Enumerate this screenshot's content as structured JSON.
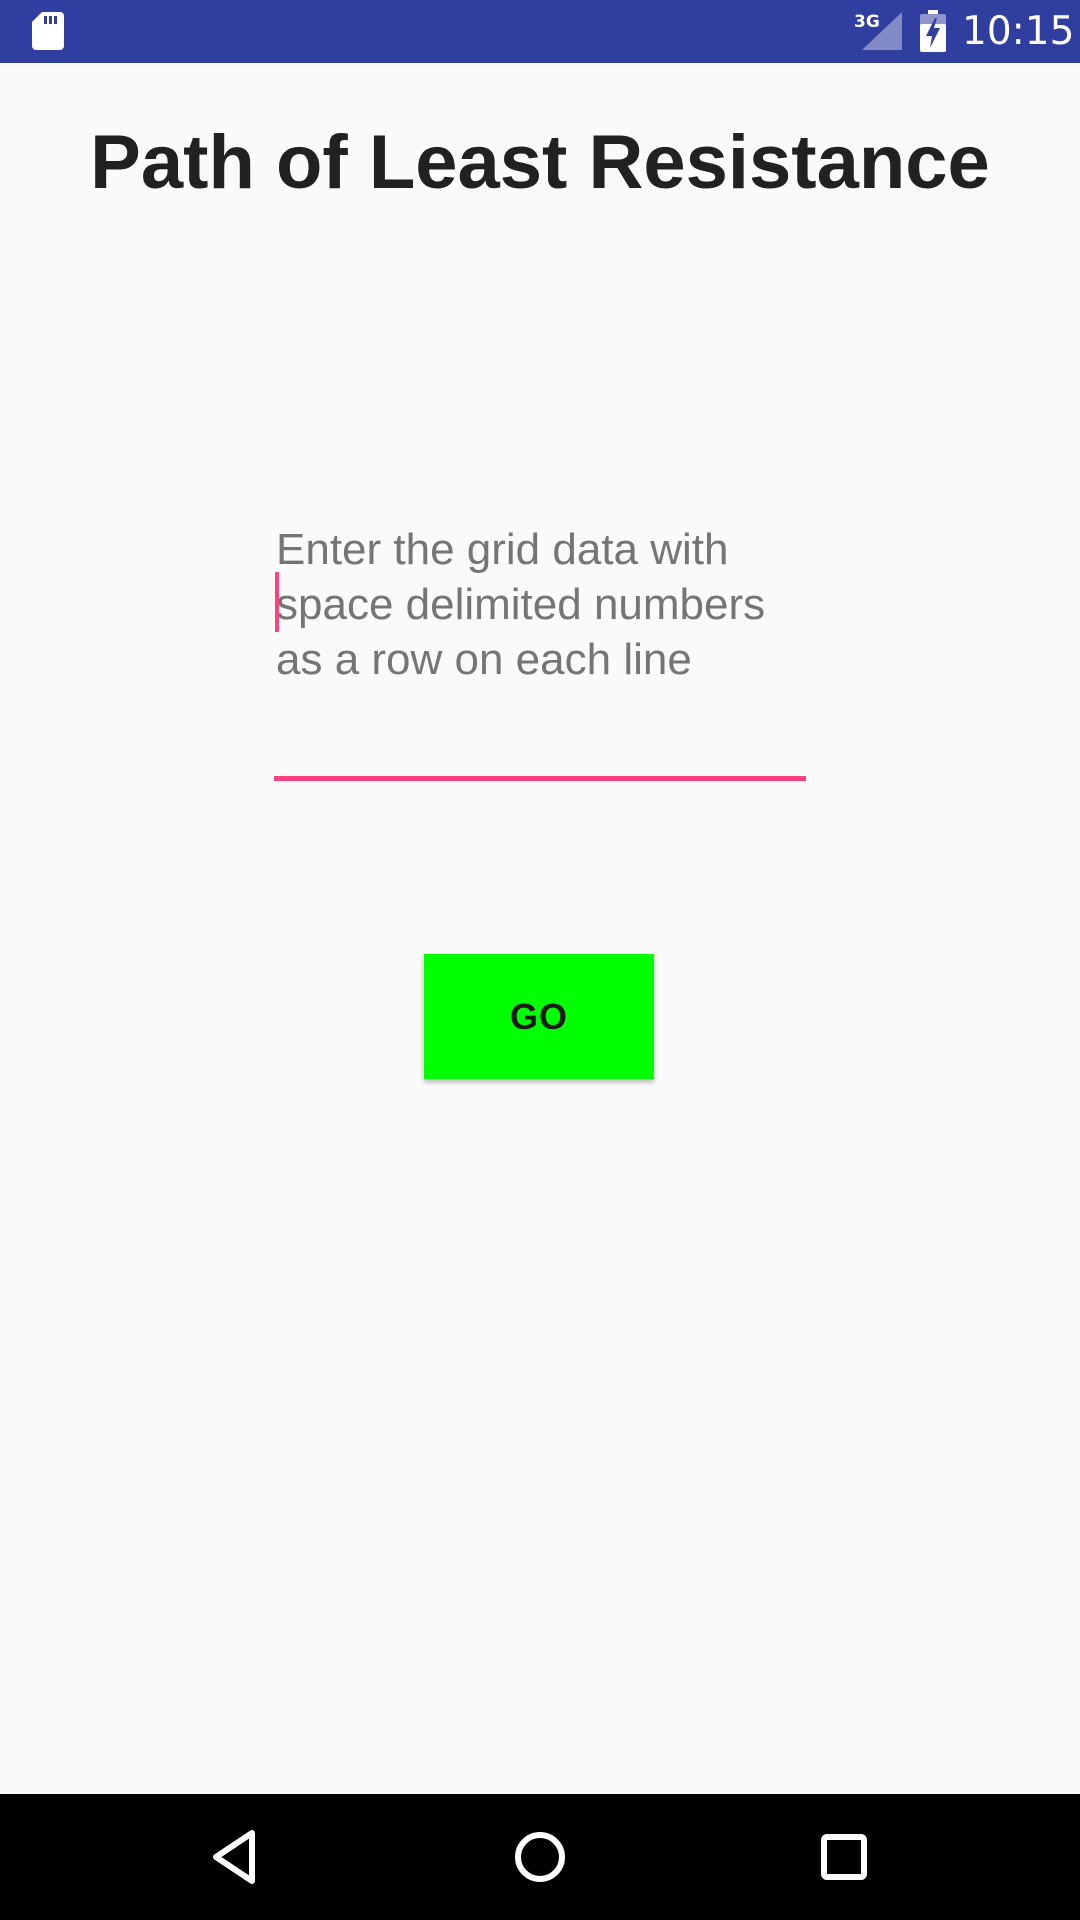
{
  "status_bar": {
    "network_label": "3G",
    "time": "10:15",
    "icons": [
      "sd-card-icon",
      "signal-icon",
      "battery-charging-icon"
    ]
  },
  "main": {
    "title": "Path of Least Resistance",
    "grid_input": {
      "value": "",
      "placeholder": "Enter the grid data with space delimited numbers as a row on each line"
    },
    "go_button_label": "GO"
  },
  "nav_bar": {
    "icons": [
      "back-icon",
      "home-icon",
      "recents-icon"
    ]
  },
  "colors": {
    "status_bar": "#303f9f",
    "accent": "#ff4081",
    "go_button": "#00ff00",
    "background": "#fafafa",
    "nav_bar": "#000000"
  }
}
